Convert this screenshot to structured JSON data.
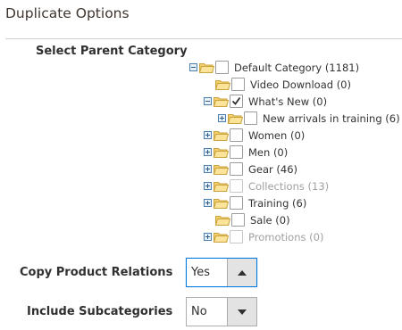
{
  "section": {
    "title": "Duplicate Options"
  },
  "parent_category": {
    "label": "Select Parent Category",
    "tree": [
      {
        "label": "Default Category (1181)",
        "checked": false,
        "disabled": false,
        "toggle": "minus"
      },
      {
        "label": "Video Download (0)",
        "checked": false,
        "disabled": false,
        "toggle": "none"
      },
      {
        "label": "What's New (0)",
        "checked": true,
        "disabled": false,
        "toggle": "minus"
      },
      {
        "label": "New arrivals in training (6)",
        "checked": false,
        "disabled": false,
        "toggle": "plus"
      },
      {
        "label": "Women (0)",
        "checked": false,
        "disabled": false,
        "toggle": "plus"
      },
      {
        "label": "Men (0)",
        "checked": false,
        "disabled": false,
        "toggle": "plus"
      },
      {
        "label": "Gear (46)",
        "checked": false,
        "disabled": false,
        "toggle": "plus"
      },
      {
        "label": "Collections (13)",
        "checked": false,
        "disabled": true,
        "toggle": "plus"
      },
      {
        "label": "Training (6)",
        "checked": false,
        "disabled": false,
        "toggle": "plus"
      },
      {
        "label": "Sale (0)",
        "checked": false,
        "disabled": false,
        "toggle": "none"
      },
      {
        "label": "Promotions (0)",
        "checked": false,
        "disabled": true,
        "toggle": "plus"
      }
    ]
  },
  "copy_relations": {
    "label": "Copy Product Relations",
    "value": "Yes",
    "arrow": "up-icon"
  },
  "include_subcategories": {
    "label": "Include Subcategories",
    "value": "No",
    "arrow": "down-icon"
  },
  "colors": {
    "focus_border": "#007bdb",
    "arrow_bg": "#e3e3e3",
    "folder": "#f4cf6b",
    "toggle": "#4a7fb0"
  }
}
